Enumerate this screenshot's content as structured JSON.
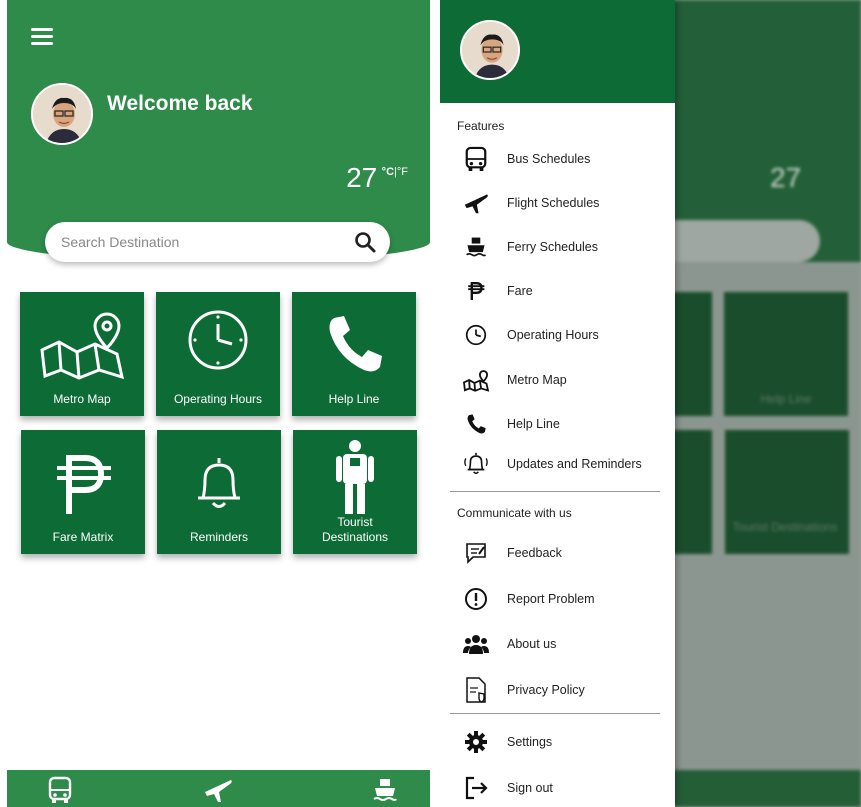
{
  "home": {
    "welcome": "Welcome back",
    "temperature": "27",
    "temp_unit_c": "°C",
    "temp_unit_sep": "|°F",
    "search_placeholder": "Search Destination",
    "tiles": [
      {
        "label": "Metro Map",
        "icon": "metro-map-icon"
      },
      {
        "label": "Operating Hours",
        "icon": "clock-icon"
      },
      {
        "label": "Help Line",
        "icon": "phone-icon"
      },
      {
        "label": "Fare Matrix",
        "icon": "peso-icon"
      },
      {
        "label": "Reminders",
        "icon": "bell-icon"
      },
      {
        "label": "Tourist Destinations",
        "icon": "tourist-icon"
      }
    ],
    "tile_lines": {
      "tourist_1": "Tourist",
      "tourist_2": "Destinations"
    },
    "bottom_nav": [
      "bus-icon",
      "plane-icon",
      "ferry-icon"
    ]
  },
  "drawer": {
    "features_title": "Features",
    "features": [
      {
        "label": "Bus Schedules",
        "icon": "bus-icon"
      },
      {
        "label": "Flight Schedules",
        "icon": "plane-icon"
      },
      {
        "label": "Ferry Schedules",
        "icon": "ferry-icon"
      },
      {
        "label": "Fare",
        "icon": "peso-icon"
      },
      {
        "label": "Operating Hours",
        "icon": "clock-icon"
      },
      {
        "label": "Metro Map",
        "icon": "metro-map-icon"
      },
      {
        "label": "Help Line",
        "icon": "phone-icon"
      },
      {
        "label": "Updates and Reminders",
        "icon": "bell-ring-icon"
      }
    ],
    "communicate_title": "Communicate with us",
    "communicate": [
      {
        "label": "Feedback",
        "icon": "feedback-icon"
      },
      {
        "label": "Report Problem",
        "icon": "alert-icon"
      },
      {
        "label": "About us",
        "icon": "group-icon"
      },
      {
        "label": "Privacy Policy",
        "icon": "policy-icon"
      }
    ],
    "account": [
      {
        "label": "Settings",
        "icon": "gear-icon"
      },
      {
        "label": "Sign out",
        "icon": "sign-out-icon"
      }
    ]
  },
  "blurred_bg": {
    "temperature": "27",
    "tile_help": "Help Line",
    "tile_tourist": "Tourist Destinations"
  },
  "colors": {
    "primary": "#2e8b4a",
    "dark": "#0d6b35",
    "accent_text": "#ffffff"
  }
}
